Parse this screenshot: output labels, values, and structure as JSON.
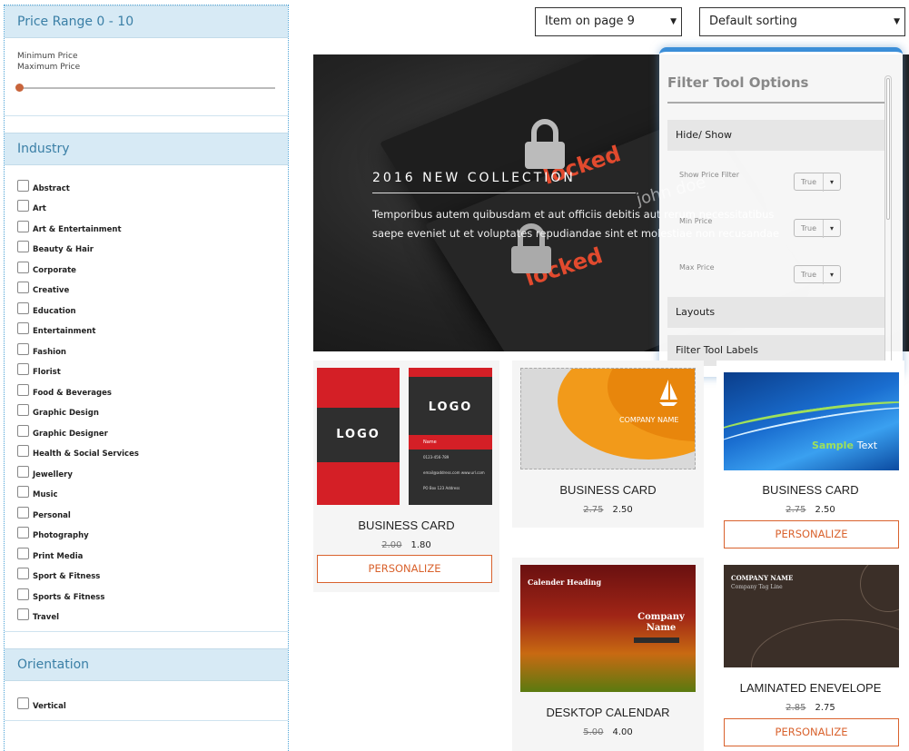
{
  "sidebar": {
    "price": {
      "title": "Price Range 0 - 10",
      "min_label": "Minimum Price",
      "max_label": "Maximum Price",
      "slider_value": 0
    },
    "industry": {
      "title": "Industry",
      "items": [
        "Abstract",
        "Art",
        "Art & Entertainment",
        "Beauty & Hair",
        "Corporate",
        "Creative",
        "Education",
        "Entertainment",
        "Fashion",
        "Florist",
        "Food & Beverages",
        "Graphic Design",
        "Graphic Designer",
        "Health & Social Services",
        "Jewellery",
        "Music",
        "Personal",
        "Photography",
        "Print Media",
        "Sport & Fitness",
        "Sports & Fitness",
        "Travel"
      ]
    },
    "orientation": {
      "title": "Orientation",
      "items": [
        "Vertical"
      ]
    }
  },
  "toolbar": {
    "items_per_page": "Item on page 9",
    "sorting": "Default sorting"
  },
  "hero": {
    "heading": "2016 NEW COLLECTION",
    "text_line1": "Temporibus autem quibusdam et aut officiis debitis aut rerum necessitatibus",
    "text_line2": "saepe eveniet ut et voluptates repudiandae sint et molestiae non recusandae",
    "card_word": "locked",
    "ghost_name": "john doe"
  },
  "filter_panel": {
    "title": "Filter Tool Options",
    "sections": {
      "hide_show": "Hide/ Show",
      "layouts": "Layouts",
      "labels": "Filter Tool Labels"
    },
    "options": [
      {
        "label": "Show Price Filter",
        "value": "True"
      },
      {
        "label": "Min Price",
        "value": "True"
      },
      {
        "label": "Max Price",
        "value": "True"
      }
    ]
  },
  "products": [
    {
      "name": "BUSINESS CARD",
      "old_price": "2.00",
      "price": "1.80",
      "button": "PERSONALIZE"
    },
    {
      "name": "BUSINESS CARD",
      "old_price": "2.75",
      "price": "2.50"
    },
    {
      "name": "BUSINESS CARD",
      "old_price": "2.75",
      "price": "2.50",
      "button": "PERSONALIZE"
    },
    {
      "name": "DESKTOP CALENDAR",
      "old_price": "5.00",
      "price": "4.00"
    },
    {
      "name": "LAMINATED ENEVELOPE",
      "old_price": "2.85",
      "price": "2.75",
      "button": "PERSONALIZE"
    }
  ],
  "thumbs": {
    "card1_logo": "LOGO",
    "card1_rows": [
      "Name",
      "0123-456-789",
      "email@address.com www.url.com",
      "PO Box 123 Address"
    ],
    "card2_company": "COMPANY NAME",
    "card3_text1": "Sample",
    "card3_text2": "Text",
    "calendar_heading": "Calender Heading",
    "calendar_company1": "Company",
    "calendar_company2": "Name",
    "envelope_company": "COMPANY NAME",
    "envelope_tagline": "Company Tag Line"
  },
  "colors": {
    "accent": "#d9622d",
    "section_bg": "#d7eaf5",
    "section_text": "#3a7fa6",
    "panel_border": "#3b8ed8"
  }
}
